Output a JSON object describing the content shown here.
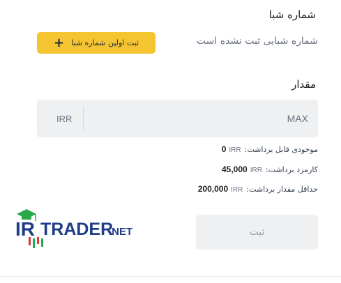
{
  "sheba": {
    "title": "شماره شبا",
    "empty_text": "شماره شبایی ثبت نشده است",
    "add_button_label": "ثبت اولین شماره شبا",
    "add_button_icon": "plus-icon"
  },
  "amount": {
    "title": "مقدار",
    "max_label": "MAX",
    "currency": "IRR"
  },
  "info": {
    "balance_label": "موجودی قابل برداشت:",
    "balance_currency": "IRR",
    "balance_value": "0",
    "fee_label": "کارمزد برداشت:",
    "fee_currency": "IRR",
    "fee_value": "45,000",
    "min_label": "حداقل مقدار برداشت:",
    "min_currency": "IRR",
    "min_value": "200,000"
  },
  "logo": {
    "text_ir": "IR",
    "text_trader": "TRADER",
    "text_net": ".NET"
  },
  "submit": {
    "label": "ثبت"
  },
  "colors": {
    "accent": "#f5c431",
    "field_bg": "#eef0f2",
    "logo_green": "#2aa84a",
    "logo_blue": "#1f3c88"
  }
}
